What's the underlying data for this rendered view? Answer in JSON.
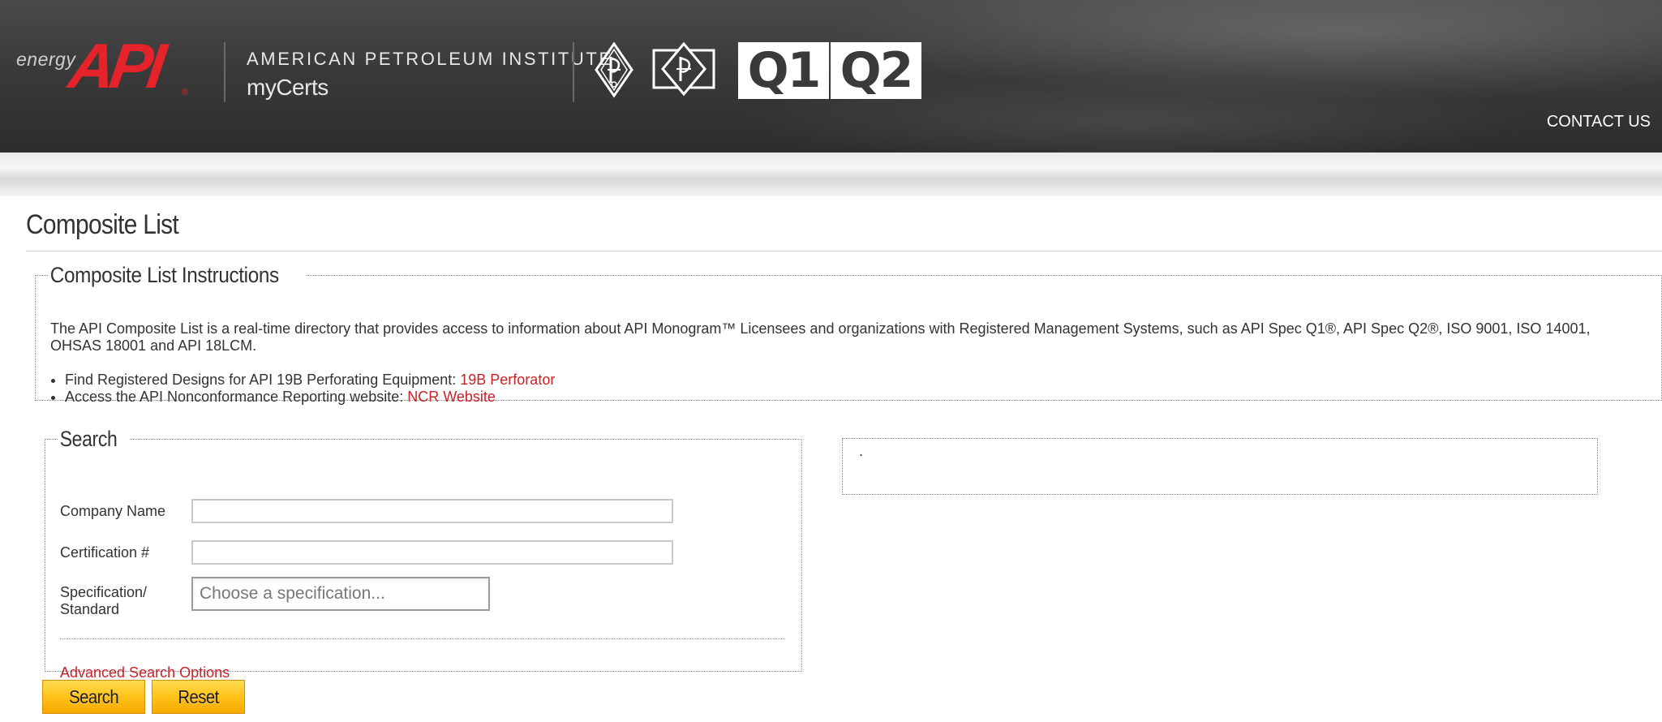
{
  "header": {
    "logo_word": "energy",
    "logo_brand": "API",
    "logo_reg": "®",
    "org_name": "AMERICAN PETROLEUM INSTITUTE",
    "app_name": "myCerts",
    "cert_logos": [
      "API Monogram",
      "API Monogram",
      "Q1",
      "Q2"
    ],
    "q1_text": "Q1",
    "q2_text": "Q2",
    "contact_label": "CONTACT US"
  },
  "page": {
    "title": "Composite List"
  },
  "instructions": {
    "legend": "Composite List Instructions",
    "text": "The API Composite List is a real-time directory that provides access to information about API Monogram™ Licensees and organizations with Registered Management Systems, such as API Spec Q1®, API Spec Q2®, ISO 9001, ISO 14001, OHSAS 18001 and API 18LCM.",
    "items": [
      {
        "text": "Find Registered Designs for API 19B Perforating Equipment: ",
        "link": "19B Perforator"
      },
      {
        "text": "Access the API Nonconformance Reporting website:  ",
        "link": "NCR Website"
      }
    ]
  },
  "search": {
    "legend": "Search",
    "company_label": "Company Name",
    "company_value": "",
    "cert_label": "Certification #",
    "cert_value": "",
    "spec_label_line1": "Specification/",
    "spec_label_line2": "Standard",
    "spec_placeholder": "Choose a specification...",
    "advanced_link": "Advanced Search Options"
  },
  "results": {
    "marker": "."
  },
  "buttons": {
    "search_label": "Search",
    "reset_label": "Reset"
  },
  "colors": {
    "header_bg": "#3a3a3a",
    "accent_red": "#cc2027",
    "button_yellow": "#ffc21a"
  }
}
